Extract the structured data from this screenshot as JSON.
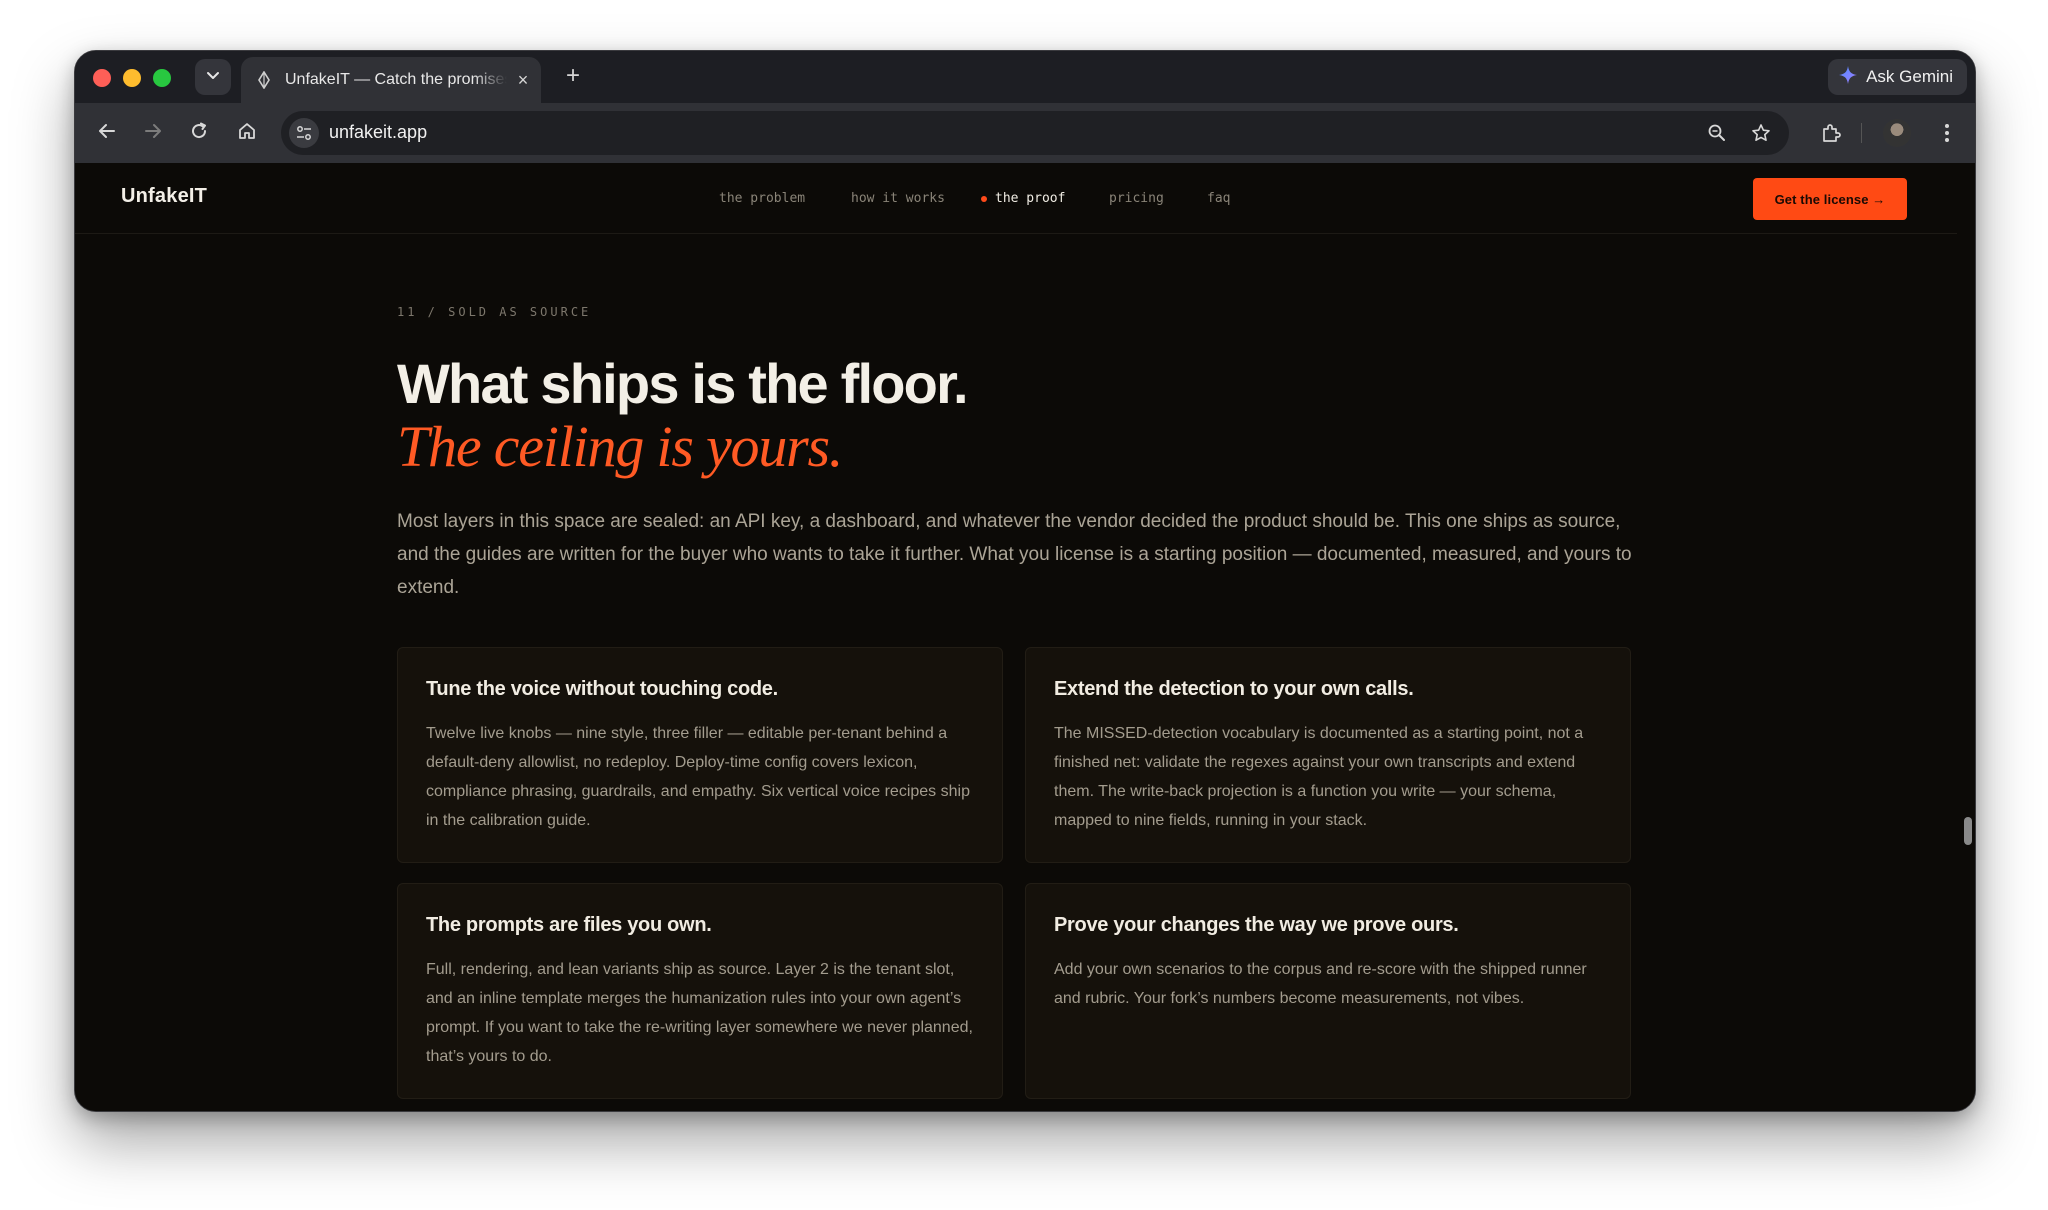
{
  "browser": {
    "tab_title": "UnfakeIT — Catch the promises",
    "tab_close": "×",
    "new_tab": "+",
    "ask_gemini": "Ask Gemini",
    "url": "unfakeit.app"
  },
  "site": {
    "brand": "UnfakeIT",
    "nav": [
      "the problem",
      "how it works",
      "the proof",
      "pricing",
      "faq"
    ],
    "active_nav": "the proof",
    "cta": "Get the license →"
  },
  "section": {
    "eyebrow": "11 / SOLD AS SOURCE",
    "headline": "What ships is the floor.",
    "headline_accent": "The ceiling is yours.",
    "lede": "Most layers in this space are sealed: an API key, a dashboard, and whatever the vendor decided the product should be. This one ships as source, and the guides are written for the buyer who wants to take it further. What you license is a starting position — documented, measured, and yours to extend.",
    "cards": [
      {
        "title": "Tune the voice without touching code.",
        "body": "Twelve live knobs — nine style, three filler — editable per-tenant behind a default-deny allowlist, no redeploy. Deploy-time config covers lexicon, compliance phrasing, guardrails, and empathy. Six vertical voice recipes ship in the calibration guide."
      },
      {
        "title": "Extend the detection to your own calls.",
        "body": "The MISSED-detection vocabulary is documented as a starting point, not a finished net: validate the regexes against your own transcripts and extend them. The write-back projection is a function you write — your schema, mapped to nine fields, running in your stack."
      },
      {
        "title": "The prompts are files you own.",
        "body": "Full, rendering, and lean variants ship as source. Layer 2 is the tenant slot, and an inline template merges the humanization rules into your own agent’s prompt. If you want to take the re-writing layer somewhere we never planned, that’s yours to do."
      },
      {
        "title": "Prove your changes the way we prove ours.",
        "body": "Add your own scenarios to the corpus and re-score with the shipped runner and rubric. Your fork’s numbers become measurements, not vibes."
      }
    ]
  },
  "colors": {
    "accent": "#ff4a14",
    "page_bg": "#0c0a07",
    "card_bg": "#15110b"
  },
  "icons": [
    "tab-list-icon",
    "site-favicon-icon",
    "gemini-sparkle-icon",
    "back-arrow-icon",
    "forward-arrow-icon",
    "reload-icon",
    "home-icon",
    "site-settings-icon",
    "zoom-icon",
    "bookmark-star-icon",
    "extensions-icon",
    "profile-avatar",
    "kebab-menu-icon"
  ]
}
